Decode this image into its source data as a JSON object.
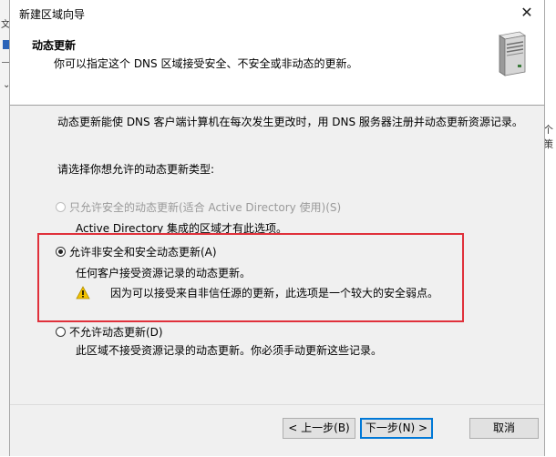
{
  "background": {
    "left_fragment_1": "文",
    "left_fragment_2": "",
    "right_fragment": "个策"
  },
  "window": {
    "title": "新建区域向导",
    "close_glyph": "✕"
  },
  "header": {
    "title": "动态更新",
    "subtitle": "你可以指定这个 DNS 区域接受安全、不安全或非动态的更新。",
    "icon": "server-icon"
  },
  "body": {
    "description": "动态更新能使 DNS 客户端计算机在每次发生更改时，用 DNS 服务器注册并动态更新资源记录。",
    "prompt": "请选择你想允许的动态更新类型:"
  },
  "options": [
    {
      "label": "只允许安全的动态更新(适合 Active Directory 使用)(S)",
      "description": "Active Directory 集成的区域才有此选项。",
      "checked": false,
      "enabled": false
    },
    {
      "label": "允许非安全和安全动态更新(A)",
      "description": "任何客户接受资源记录的动态更新。",
      "warning": "因为可以接受来自非信任源的更新，此选项是一个较大的安全弱点。",
      "checked": true,
      "enabled": true
    },
    {
      "label": "不允许动态更新(D)",
      "description": "此区域不接受资源记录的动态更新。你必须手动更新这些记录。",
      "checked": false,
      "enabled": true
    }
  ],
  "buttons": {
    "back": "< 上一步(B)",
    "next": "下一步(N) >",
    "cancel": "取消"
  },
  "colors": {
    "highlight": "#e0313b",
    "dialog_bg": "#f0f0f0",
    "warning": "#f2c200"
  }
}
